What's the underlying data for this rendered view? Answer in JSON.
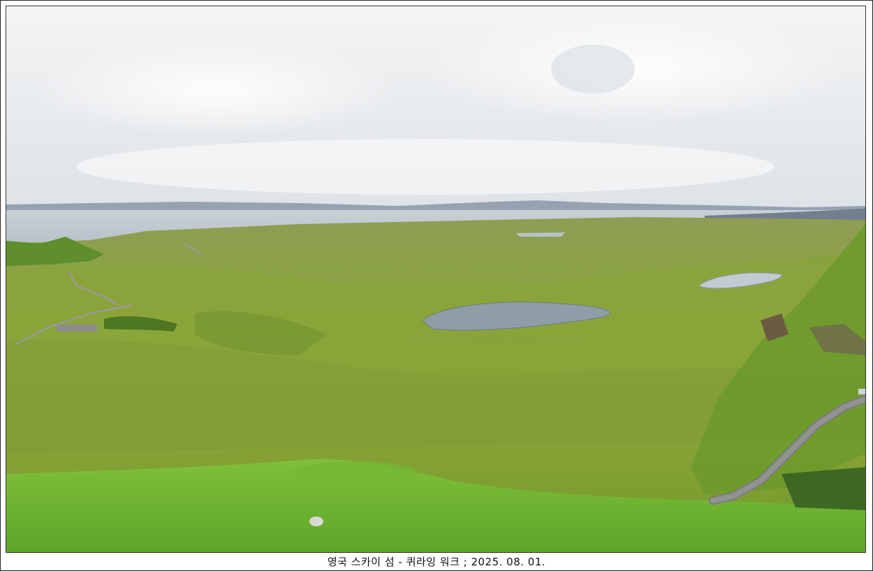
{
  "caption": "영국 스카이 섬 - 퀴라잉 워크 ; 2025. 08. 01.",
  "colors": {
    "sky": "#e9ecef",
    "sea": "#bfc8cf",
    "mountains": "#6f7f93",
    "grass_light": "#86bf3a",
    "grass_mid": "#8ba63b",
    "moor": "#7f9540",
    "lake": "#9aa7b3",
    "road": "#7e7e7e"
  }
}
